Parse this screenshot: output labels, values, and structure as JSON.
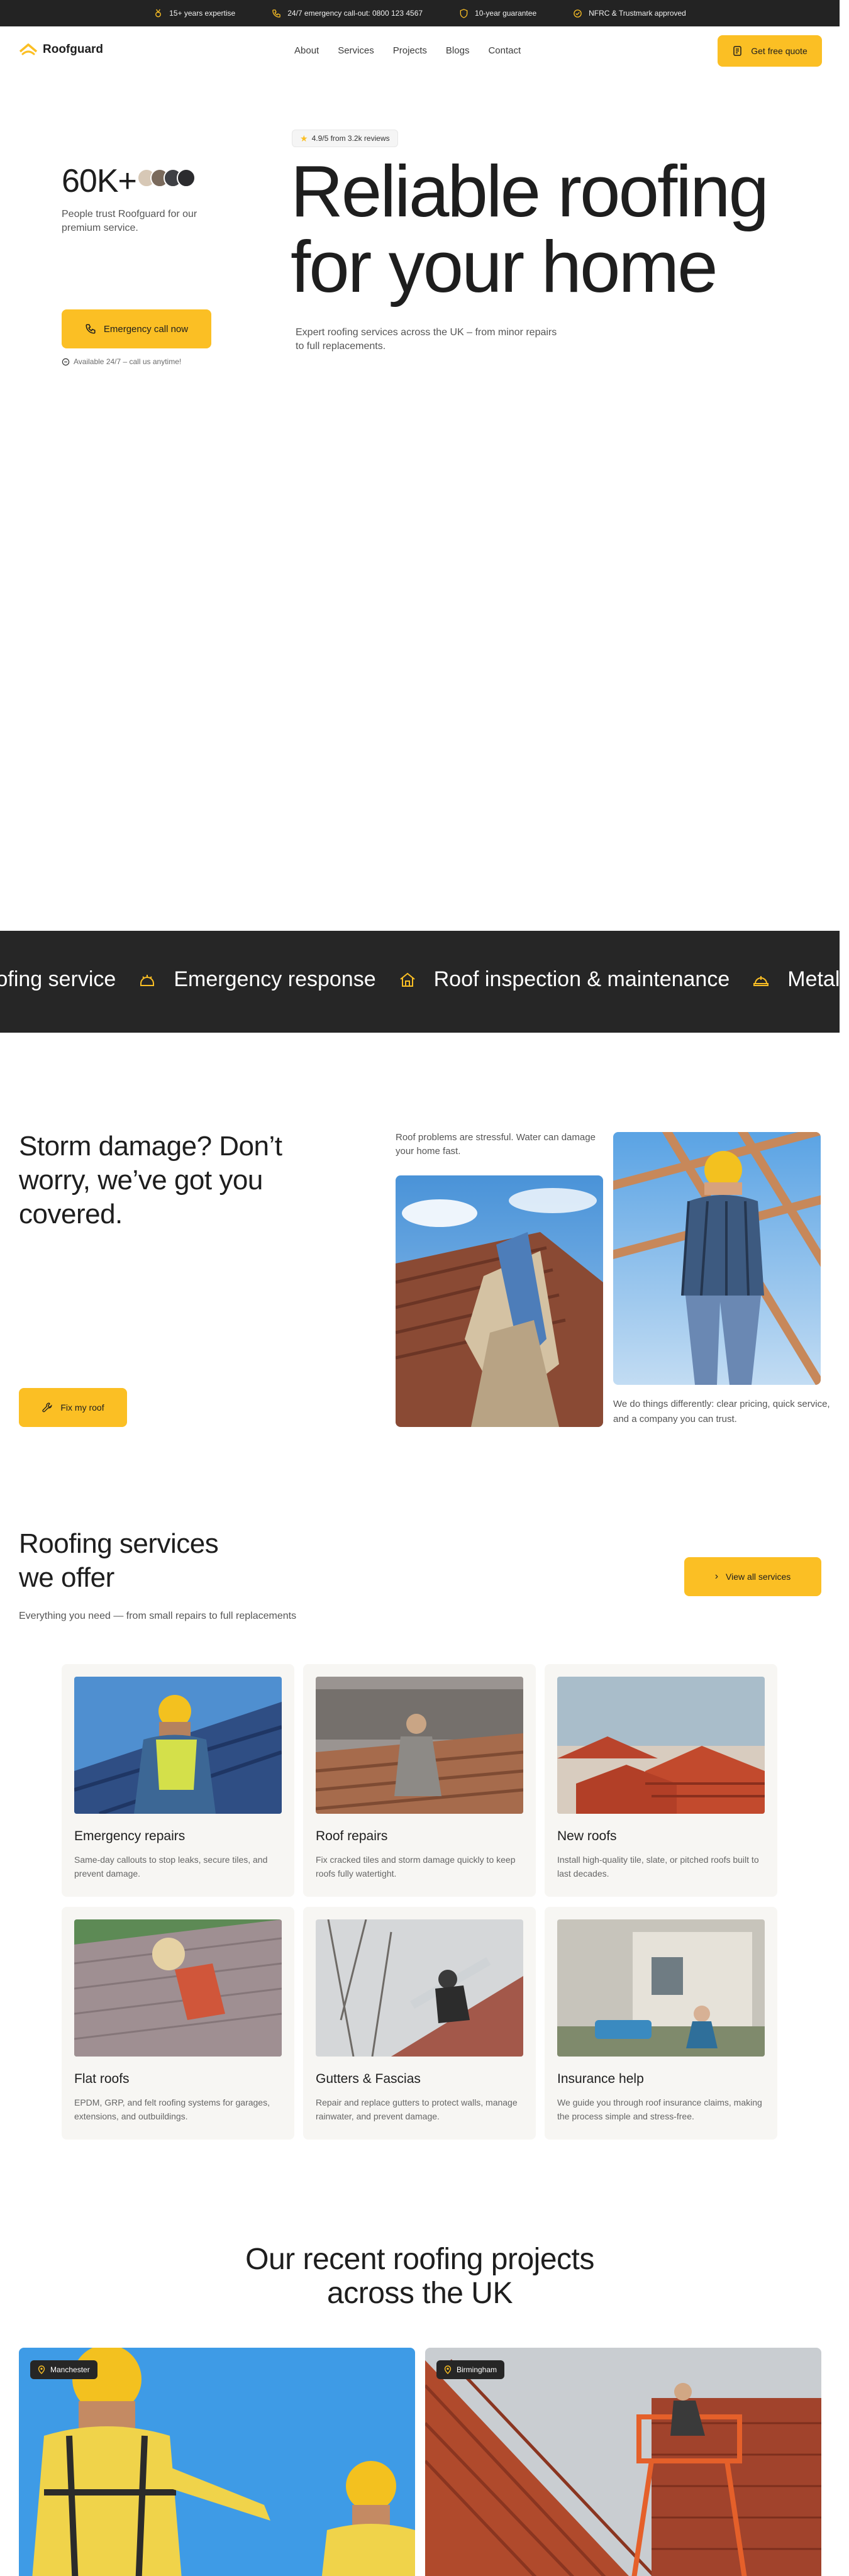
{
  "topbar": {
    "items": [
      {
        "icon": "medal-icon",
        "text": "15+ years expertise"
      },
      {
        "icon": "phone-icon",
        "text": "24/7 emergency call-out: 0800 123 4567"
      },
      {
        "icon": "shield-icon",
        "text": "10-year guarantee"
      },
      {
        "icon": "badge-check-icon",
        "text": "NFRC & Trustmark approved"
      }
    ]
  },
  "nav": {
    "logo": "Roofguard",
    "menu": [
      "About",
      "Services",
      "Projects",
      "Blogs",
      "Contact"
    ],
    "cta": "Get free quote"
  },
  "hero": {
    "stat": "60K+",
    "stat_text": "People trust Roofguard for our premium service.",
    "emergency_cta": "Emergency call now",
    "availability": "Available 24/7 – call us anytime!",
    "rating": "4.9/5 from 3.2k reviews",
    "title_line1": "Reliable roofing",
    "title_line2": "for your home",
    "subtitle": "Expert roofing services across the UK – from minor repairs to full replacements."
  },
  "marquee": {
    "items": [
      "Roofing service",
      "Emergency response",
      "Roof inspection & maintenance",
      "Metal roofing"
    ]
  },
  "storm": {
    "title": "Storm damage? Don’t worry, we’ve got you covered.",
    "cta": "Fix my roof",
    "note": "Roof problems are stressful. Water can damage your home fast.",
    "caption": "We do things differently: clear pricing, quick service, and a company you can trust."
  },
  "services": {
    "title_line1": "Roofing services",
    "title_line2": "we offer",
    "subtitle": "Everything you need — from small repairs to full replacements",
    "cta": "View all services",
    "cards": [
      {
        "title": "Emergency repairs",
        "desc": "Same-day callouts to stop leaks, secure tiles, and prevent damage."
      },
      {
        "title": "Roof repairs",
        "desc": "Fix cracked tiles and storm damage quickly to keep roofs fully watertight."
      },
      {
        "title": "New roofs",
        "desc": "Install high-quality tile, slate, or pitched roofs built to last decades."
      },
      {
        "title": "Flat roofs",
        "desc": "EPDM, GRP, and felt roofing systems for garages, extensions, and outbuildings."
      },
      {
        "title": "Gutters & Fascias",
        "desc": "Repair and replace gutters to protect walls, manage rainwater, and prevent damage."
      },
      {
        "title": "Insurance help",
        "desc": "We guide you through roof insurance claims, making the process simple and stress-free."
      }
    ]
  },
  "projects": {
    "title_line1": "Our recent roofing projects",
    "title_line2": "across the UK",
    "items": [
      {
        "location": "Manchester"
      },
      {
        "location": "Birmingham"
      }
    ]
  },
  "colors": {
    "accent": "#fbbf24",
    "dark": "#262626",
    "card_bg": "#f7f6f3"
  }
}
